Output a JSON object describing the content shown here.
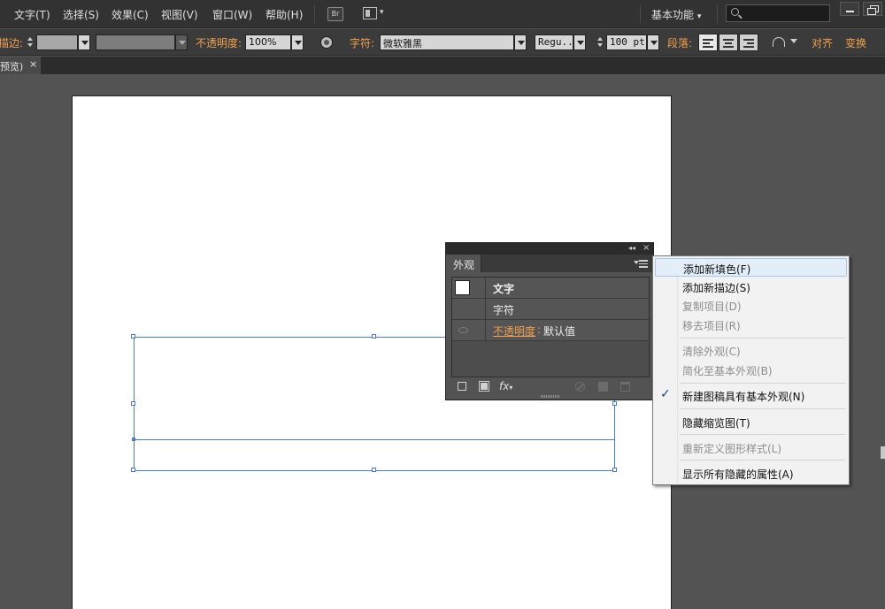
{
  "menubar": {
    "items": [
      "文字(T)",
      "选择(S)",
      "效果(C)",
      "视图(V)",
      "窗口(W)",
      "帮助(H)"
    ],
    "bridge_label": "Br",
    "workspace": "基本功能",
    "search_placeholder": ""
  },
  "control_bar": {
    "stroke_label": "描边:",
    "opacity_label": "不透明度:",
    "opacity_value": "100%",
    "character_label": "字符:",
    "font_family": "微软雅黑",
    "font_style": "Regu...",
    "font_size": "100 pt",
    "paragraph_label": "段落:",
    "align_label": "对齐",
    "transform_label": "变换"
  },
  "document_tab": {
    "label": "预览)",
    "close": "×"
  },
  "appearance_panel": {
    "title": "外观",
    "collapse_glyph": "◂◂",
    "close_glyph": "×",
    "rows": {
      "object": "文字",
      "character": "字符",
      "opacity_label": "不透明度",
      "opacity_value": "默认值"
    },
    "footer": {
      "fx_label": "fx"
    }
  },
  "context_menu": {
    "items": [
      {
        "label": "添加新填色(F)",
        "enabled": true,
        "highlighted": true
      },
      {
        "label": "添加新描边(S)",
        "enabled": true
      },
      {
        "label": "复制项目(D)",
        "enabled": false
      },
      {
        "label": "移去项目(R)",
        "enabled": false
      },
      {
        "label": "清除外观(C)",
        "enabled": false
      },
      {
        "label": "简化至基本外观(B)",
        "enabled": false
      },
      {
        "label": "新建图稿具有基本外观(N)",
        "enabled": true,
        "checked": true
      },
      {
        "label": "隐藏缩览图(T)",
        "enabled": true
      },
      {
        "label": "重新定义图形样式(L)",
        "enabled": false
      },
      {
        "label": "显示所有隐藏的属性(A)",
        "enabled": true
      }
    ],
    "check_glyph": "✓"
  },
  "colors": {
    "accent_orange": "#f0a050",
    "menu_highlight": "#e4eef9",
    "selection_blue": "#4a7ec0",
    "ui_dark": "#323232",
    "canvas_gray": "#535353"
  }
}
